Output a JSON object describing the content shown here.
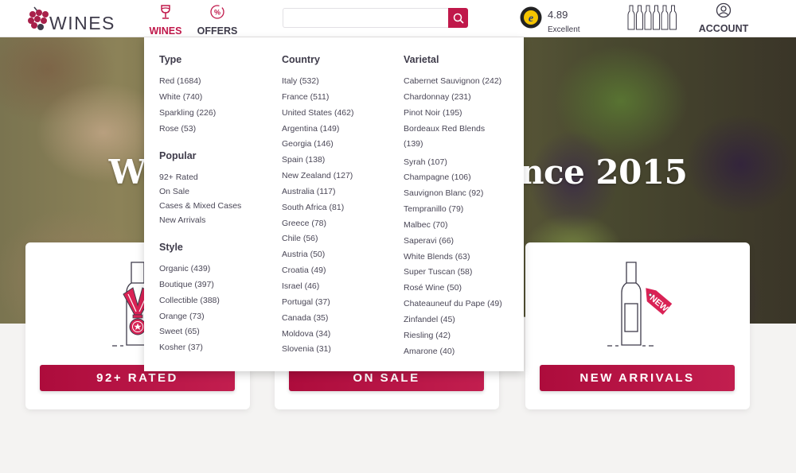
{
  "header": {
    "logo_text": "WINES",
    "nav": [
      {
        "label": "WINES",
        "icon": "wine-glass-icon",
        "active": true
      },
      {
        "label": "OFFERS",
        "icon": "percent-badge-icon",
        "active": false
      }
    ],
    "search": {
      "value": "",
      "placeholder": ""
    },
    "trust": {
      "score": "4.89",
      "label": "Excellent"
    },
    "account_label": "ACCOUNT"
  },
  "hero": {
    "title_left": "We",
    "title_right": "since 2015"
  },
  "menu": {
    "type": {
      "heading": "Type",
      "items": [
        "Red (1684)",
        "White (740)",
        "Sparkling (226)",
        "Rose (53)"
      ]
    },
    "popular": {
      "heading": "Popular",
      "items": [
        "92+ Rated",
        "On Sale",
        "Cases & Mixed Cases",
        "New Arrivals"
      ]
    },
    "style": {
      "heading": "Style",
      "items": [
        "Organic (439)",
        "Boutique (397)",
        "Collectible (388)",
        "Orange (73)",
        "Sweet (65)",
        "Kosher (37)"
      ]
    },
    "country": {
      "heading": "Country",
      "items": [
        "Italy (532)",
        "France (511)",
        "United States (462)",
        "Argentina (149)",
        "Georgia (146)",
        "Spain (138)",
        "New Zealand (127)",
        "Australia (117)",
        "South Africa (81)",
        "Greece (78)",
        "Chile (56)",
        "Austria (50)",
        "Croatia (49)",
        "Israel (46)",
        "Portugal (37)",
        "Canada (35)",
        "Moldova (34)",
        "Slovenia (31)"
      ]
    },
    "varietal": {
      "heading": "Varietal",
      "items": [
        "Cabernet Sauvignon (242)",
        "Chardonnay (231)",
        "Pinot Noir (195)",
        "Bordeaux Red Blends (139)",
        "Syrah (107)",
        "Champagne (106)",
        "Sauvignon Blanc (92)",
        "Tempranillo (79)",
        "Malbec (70)",
        "Saperavi (66)",
        "White Blends (63)",
        "Super Tuscan (58)",
        "Rosé Wine (50)",
        "Chateauneuf du Pape (49)",
        "Zinfandel (45)",
        "Riesling (42)",
        "Amarone (40)"
      ]
    }
  },
  "cards": [
    {
      "button": "92+ RATED",
      "icon": "medal-bottle-icon"
    },
    {
      "button": "ON SALE",
      "icon": "sale-bottle-icon"
    },
    {
      "button": "NEW ARRIVALS",
      "icon": "new-tag-bottle-icon",
      "tag_text": "NEW"
    }
  ],
  "colors": {
    "brand": "#c0184a",
    "text": "#3e3b4a"
  }
}
